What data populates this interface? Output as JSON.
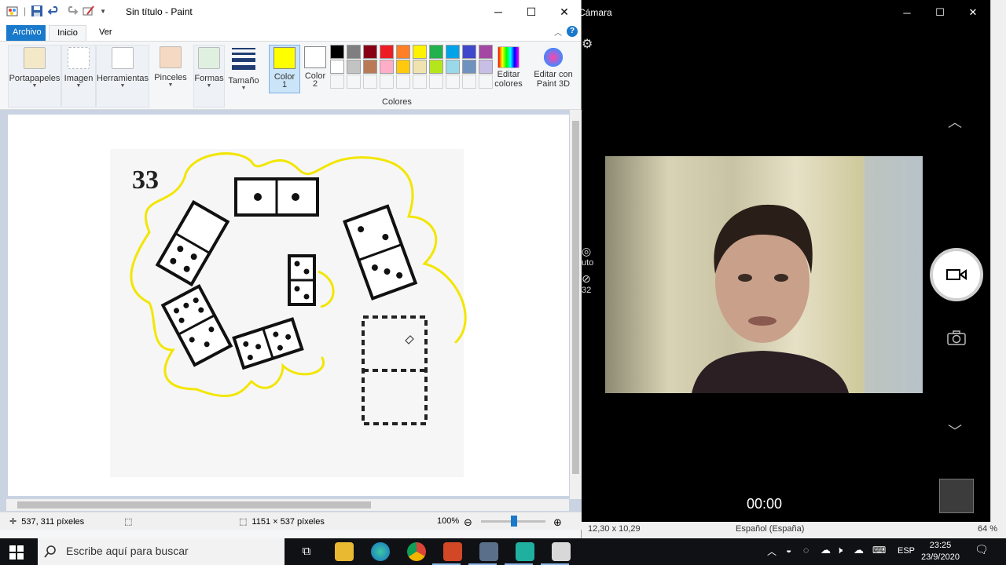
{
  "paint": {
    "title": "Sin título - Paint",
    "tabs": [
      "Archivo",
      "Inicio",
      "Ver"
    ],
    "ribbon": {
      "portapapeles": "Portapapeles",
      "imagen": "Imagen",
      "herramientas": "Herramientas",
      "pinceles": "Pinceles",
      "formas": "Formas",
      "tamano": "Tamaño",
      "color1": "Color 1",
      "color1_num": "1",
      "color1_word": "Color",
      "color2_word": "Color",
      "color2_num": "2",
      "editar_colores_1": "Editar",
      "editar_colores_2": "colores",
      "editar_3d_1": "Editar con",
      "editar_3d_2": "Paint 3D",
      "colores_group": "Colores"
    },
    "palette_row1": [
      "#000000",
      "#7f7f7f",
      "#880015",
      "#ed1c24",
      "#ff7f27",
      "#fff200",
      "#22b14c",
      "#00a2e8",
      "#3f48cc",
      "#a349a4"
    ],
    "palette_row2": [
      "#ffffff",
      "#c3c3c3",
      "#b97a57",
      "#ffaec9",
      "#ffc90e",
      "#efe4b0",
      "#b5e61d",
      "#99d9ea",
      "#7092be",
      "#c8bfe7"
    ],
    "active_color1": "#ffff00",
    "active_color2": "#ffffff",
    "canvas": {
      "number_label": "33"
    },
    "status": {
      "cursor_pos": "537, 311 píxeles",
      "image_size": "1151 × 537 píxeles",
      "zoom": "100%"
    }
  },
  "camera": {
    "title": "Cámara",
    "side_label_1": "uto",
    "side_label_2": "32",
    "timer": "00:00"
  },
  "background": {
    "ppt_size": "12,30 x 10,29",
    "language": "Español (España)",
    "zoom_pct": "64 %"
  },
  "taskbar": {
    "search_placeholder": "Escribe aquí para buscar",
    "lang": "ESP",
    "time": "23:25",
    "date": "23/9/2020"
  }
}
